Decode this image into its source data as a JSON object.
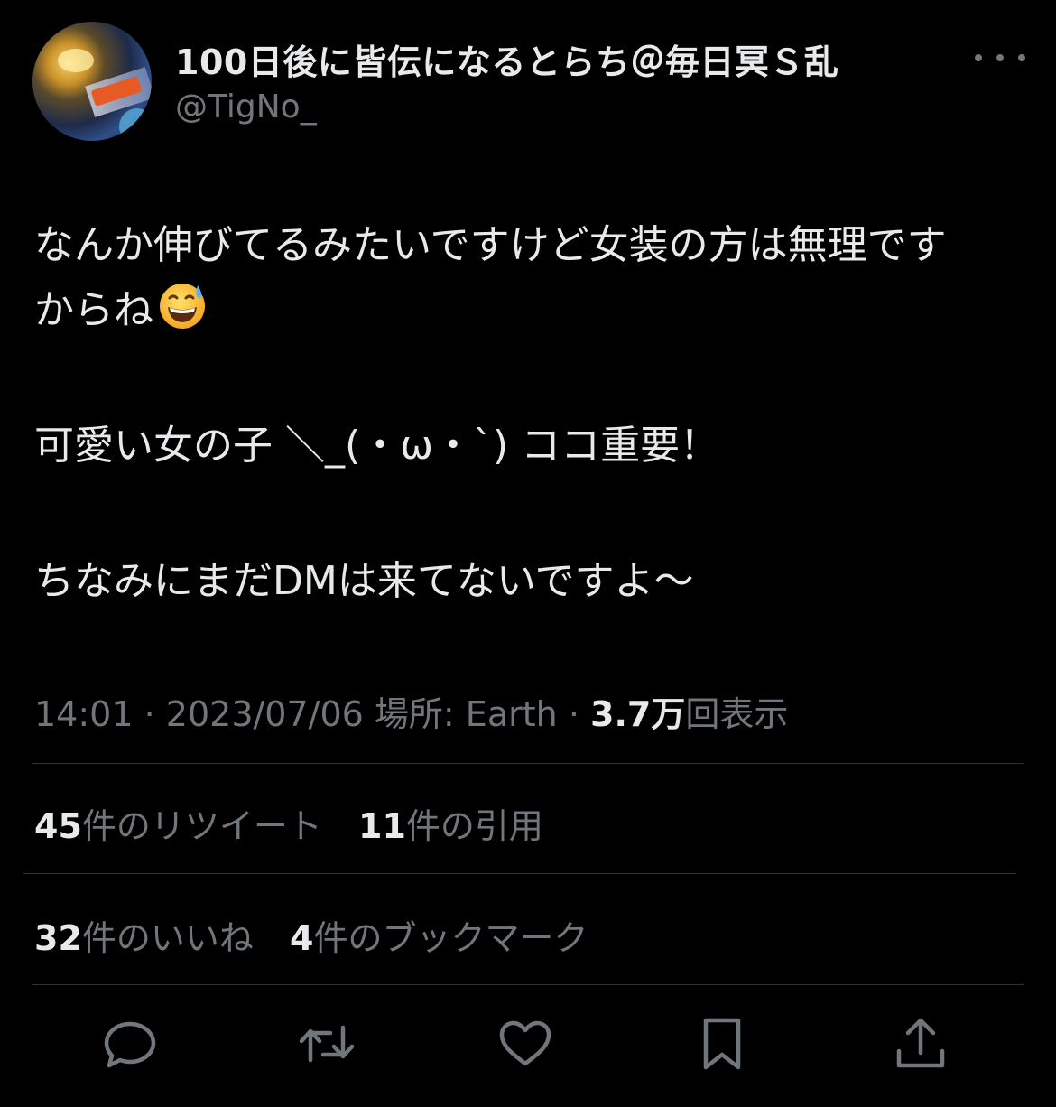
{
  "author": {
    "display_name": "100日後に皆伝になるとらち＠毎日冥Ｓ乱",
    "handle": "@TigNo_"
  },
  "tweet": {
    "line1": "なんか伸びてるみたいですけど女装の方は無理です",
    "line2": "からね",
    "line2_emoji": "grinning-face-with-sweat-emoji",
    "line3": "可愛い女の子 ＼_(・ω・`) ココ重要！",
    "line4": "ちなみにまだDMは来てないですよ〜"
  },
  "meta": {
    "time": "14:01",
    "separator": "·",
    "date": "2023/07/06",
    "location": "場所: Earth",
    "views_count": "3.7万",
    "views_label": "回表示"
  },
  "stats": {
    "retweets_count": "45",
    "retweets_label": "件のリツイート",
    "quotes_count": "11",
    "quotes_label": "件の引用",
    "likes_count": "32",
    "likes_label": "件のいいね",
    "bookmarks_count": "4",
    "bookmarks_label": "件のブックマーク"
  },
  "actions": {
    "icons": [
      "reply-icon",
      "retweet-icon",
      "like-icon",
      "bookmark-icon",
      "share-icon"
    ]
  },
  "colors": {
    "background": "#000000",
    "primary_text": "#e7e9ea",
    "secondary_text": "#71767b",
    "divider": "#2f3336"
  }
}
